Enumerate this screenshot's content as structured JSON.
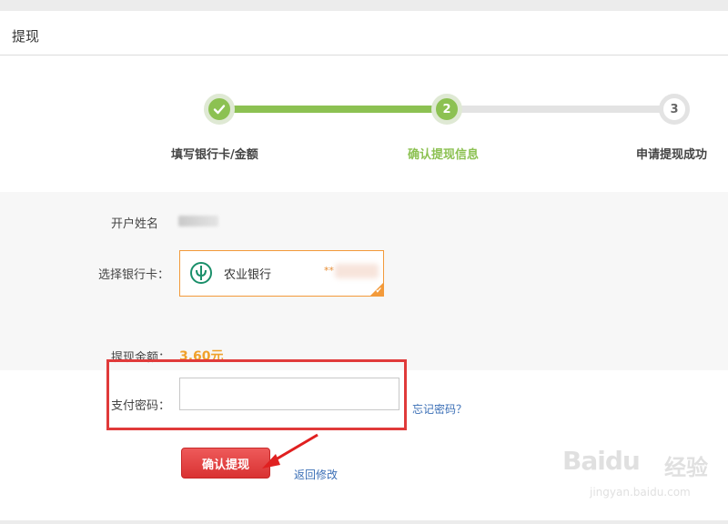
{
  "header": {
    "title": "提现"
  },
  "steps": [
    {
      "number": "",
      "label": "填写银行卡/金额",
      "state": "done"
    },
    {
      "number": "2",
      "label": "确认提现信息",
      "state": "current"
    },
    {
      "number": "3",
      "label": "申请提现成功",
      "state": "todo"
    }
  ],
  "form": {
    "account_name_label": "开户姓名",
    "bank_card_label": "选择银行卡：",
    "bank_name": "农业银行",
    "card_number_masked": "**",
    "amount_label": "提现金额：",
    "amount_value": "3.60元",
    "password_label": "支付密码：",
    "password_value": "",
    "forgot_password_link": "忘记密码？",
    "confirm_button": "确认提现",
    "back_link": "返回修改"
  },
  "watermark": {
    "brand": "Baidu",
    "brand_cn": "经验",
    "url": "jingyan.baidu.com"
  },
  "colors": {
    "success": "#8cc152",
    "accent": "#f39a3a",
    "amount": "#f0a12b",
    "danger": "#e03a3a",
    "link": "#3b6fb6"
  }
}
